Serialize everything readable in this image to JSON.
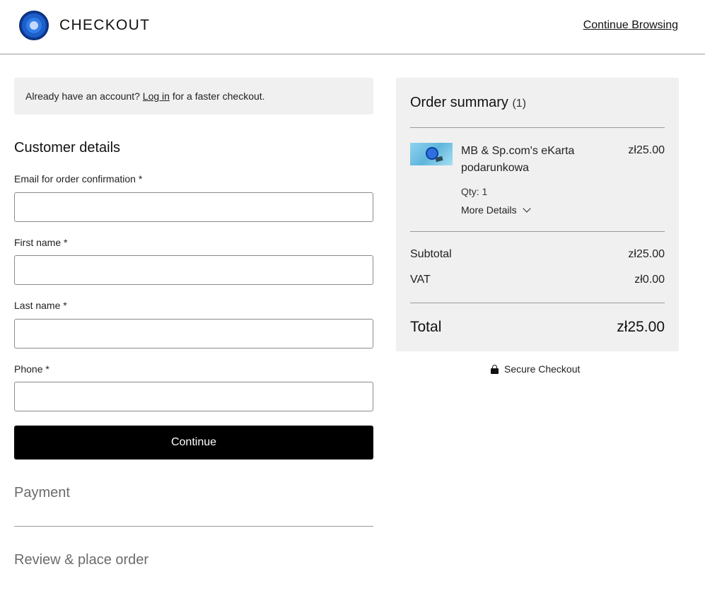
{
  "header": {
    "title": "CHECKOUT",
    "continue_browsing": "Continue Browsing",
    "logo_icon": "store-logo-icon"
  },
  "login_prompt": {
    "prefix": "Already have an account? ",
    "link": "Log in",
    "suffix": " for a faster checkout."
  },
  "customer_details": {
    "title": "Customer details",
    "fields": [
      {
        "label": "Email for order confirmation *",
        "value": ""
      },
      {
        "label": "First name *",
        "value": ""
      },
      {
        "label": "Last name *",
        "value": ""
      },
      {
        "label": "Phone *",
        "value": ""
      }
    ],
    "continue_label": "Continue"
  },
  "steps": {
    "payment": "Payment",
    "review": "Review & place order"
  },
  "order_summary": {
    "title": "Order summary",
    "count": "(1)",
    "item": {
      "name": "MB & Sp.com's eKarta podarunkowa",
      "price": "zł25.00",
      "qty": "Qty: 1",
      "more_details": "More Details"
    },
    "subtotal_label": "Subtotal",
    "subtotal_value": "zł25.00",
    "vat_label": "VAT",
    "vat_value": "zł0.00",
    "total_label": "Total",
    "total_value": "zł25.00"
  },
  "secure_checkout": "Secure Checkout",
  "colors": {
    "primary_button": "#000000",
    "panel_background": "#f0f0f0",
    "muted_text": "#6b6b6b"
  }
}
